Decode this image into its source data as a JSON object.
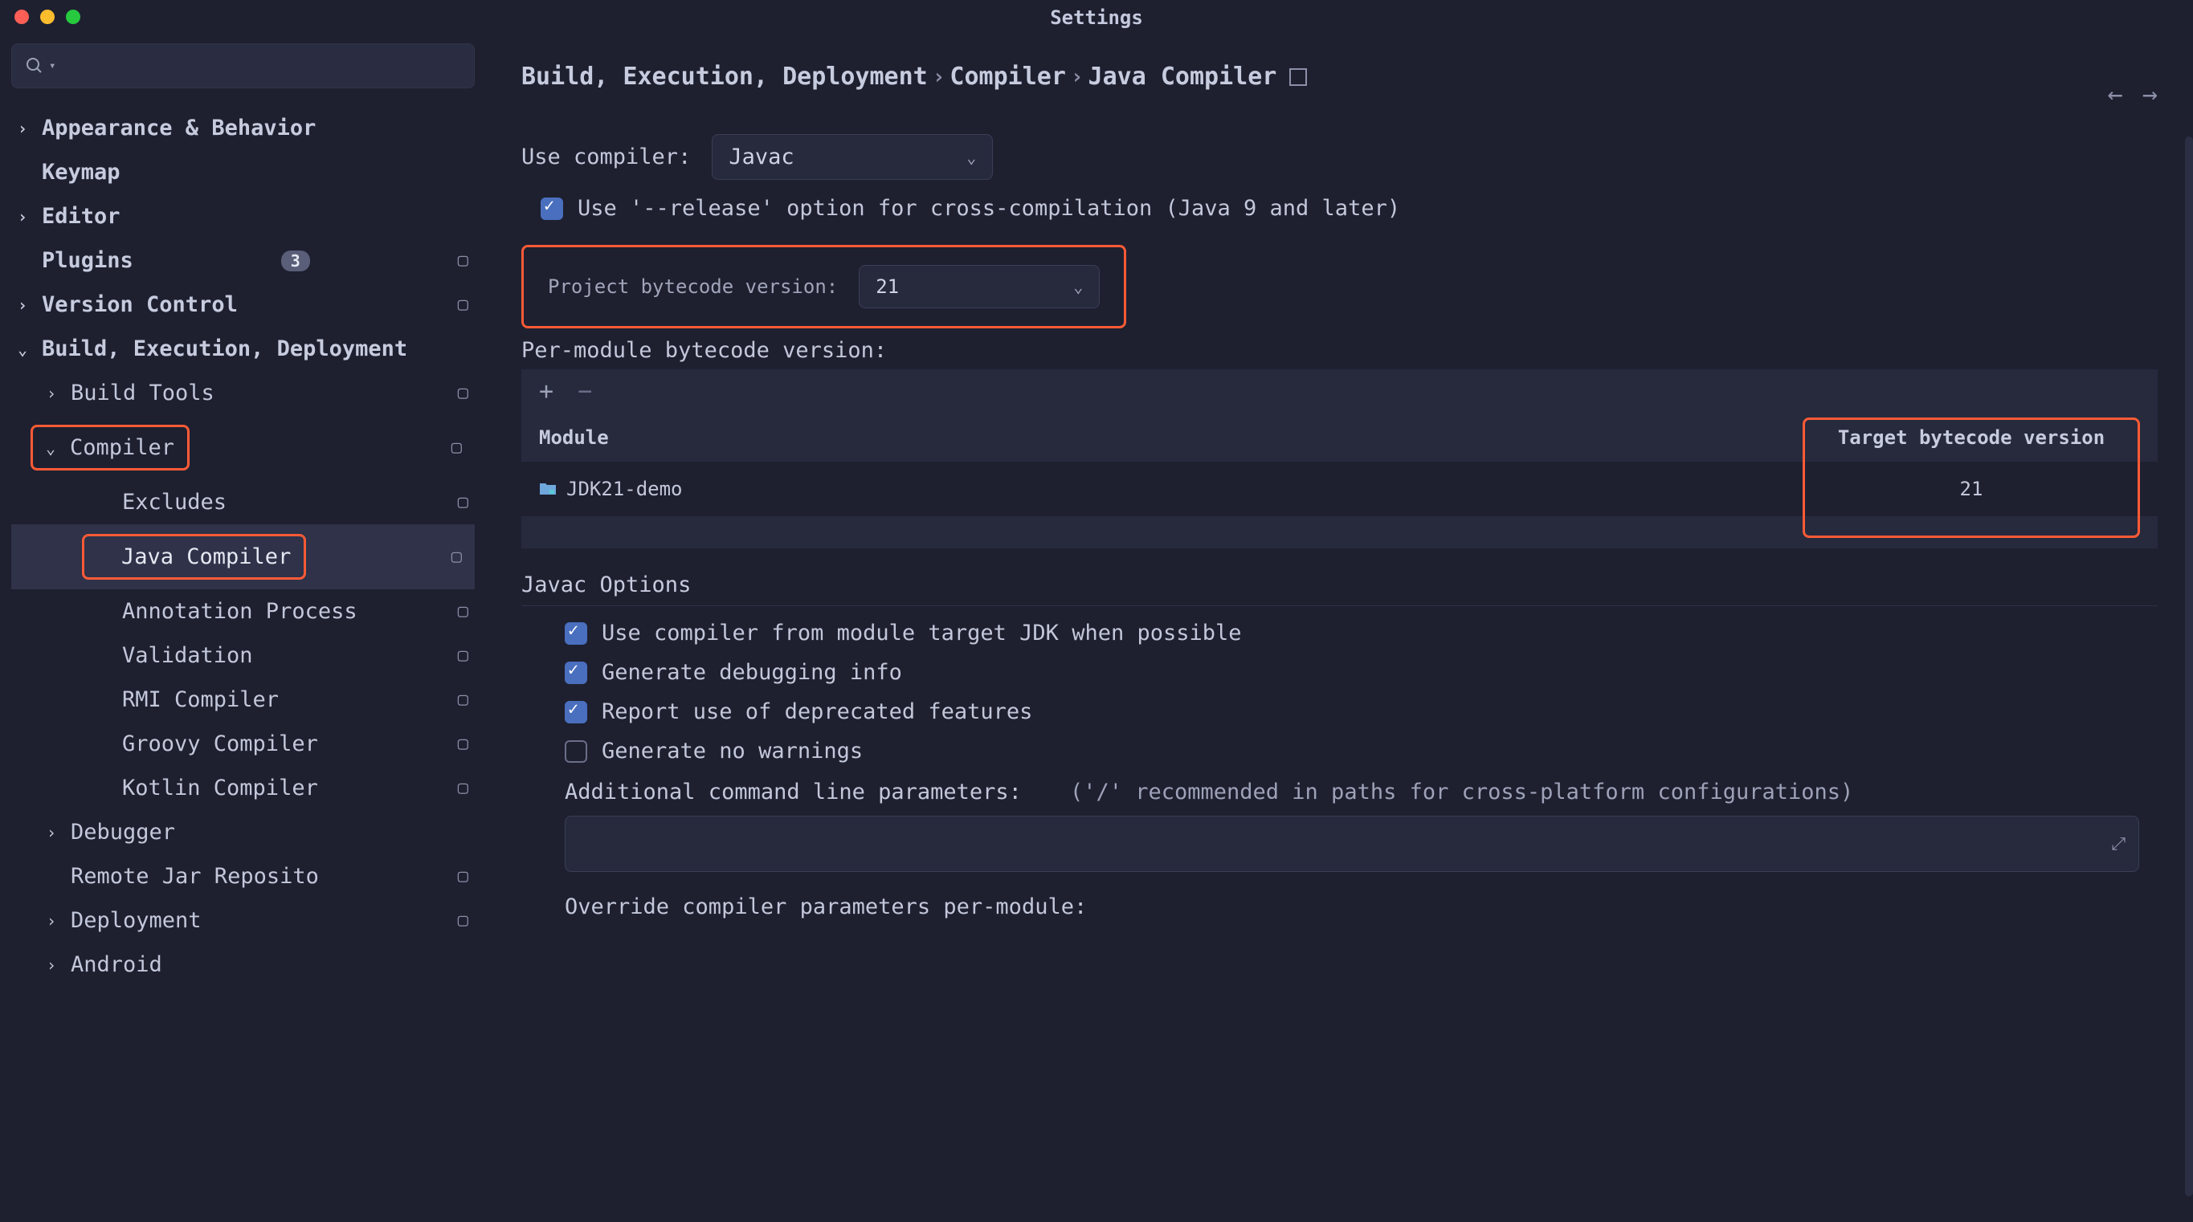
{
  "window_title": "Settings",
  "traffic": {},
  "sidebar": {
    "search_placeholder": "",
    "items": [
      {
        "label": "Appearance & Behavior",
        "level": 1,
        "chev": "›"
      },
      {
        "label": "Keymap",
        "level": 1,
        "chev": ""
      },
      {
        "label": "Editor",
        "level": 1,
        "chev": "›"
      },
      {
        "label": "Plugins",
        "level": 1,
        "chev": "",
        "badge": "3",
        "proj": true
      },
      {
        "label": "Version Control",
        "level": 1,
        "chev": "›",
        "proj": true
      },
      {
        "label": "Build, Execution, Deployment",
        "level": 1,
        "chev": "⌄"
      },
      {
        "label": "Build Tools",
        "level": 2,
        "chev": "›",
        "proj": true
      },
      {
        "label": "Compiler",
        "level": 2,
        "chev": "⌄",
        "proj": true,
        "highlight": true
      },
      {
        "label": "Excludes",
        "level": 3,
        "chev": "",
        "proj": true
      },
      {
        "label": "Java Compiler",
        "level": 3,
        "chev": "",
        "proj": true,
        "selected": true,
        "highlight": true
      },
      {
        "label": "Annotation Process",
        "level": 3,
        "chev": "",
        "proj": true
      },
      {
        "label": "Validation",
        "level": 3,
        "chev": "",
        "proj": true
      },
      {
        "label": "RMI Compiler",
        "level": 3,
        "chev": "",
        "proj": true
      },
      {
        "label": "Groovy Compiler",
        "level": 3,
        "chev": "",
        "proj": true
      },
      {
        "label": "Kotlin Compiler",
        "level": 3,
        "chev": "",
        "proj": true
      },
      {
        "label": "Debugger",
        "level": 2,
        "chev": "›"
      },
      {
        "label": "Remote Jar Reposito",
        "level": 2,
        "chev": "",
        "proj": true
      },
      {
        "label": "Deployment",
        "level": 2,
        "chev": "›",
        "proj": true
      },
      {
        "label": "Android",
        "level": 2,
        "chev": "›"
      }
    ]
  },
  "breadcrumbs": {
    "part1": "Build, Execution, Deployment",
    "part2": "Compiler",
    "part3": "Java Compiler"
  },
  "form": {
    "use_compiler_label": "Use compiler:",
    "use_compiler_value": "Javac",
    "release_checkbox": "Use '--release' option for cross-compilation (Java 9 and later)",
    "bytecode_label": "Project bytecode version:",
    "bytecode_value": "21",
    "per_module_label": "Per-module bytecode version:"
  },
  "table": {
    "col_module": "Module",
    "col_target": "Target bytecode version",
    "rows": [
      {
        "module": "JDK21-demo",
        "target": "21"
      }
    ]
  },
  "javac": {
    "heading": "Javac Options",
    "opt1": "Use compiler from module target JDK when possible",
    "opt2": "Generate debugging info",
    "opt3": "Report use of deprecated features",
    "opt4": "Generate no warnings",
    "params_label": "Additional command line parameters:",
    "params_hint": "('/' recommended in paths for cross-platform configurations)",
    "override_label": "Override compiler parameters per-module:"
  }
}
